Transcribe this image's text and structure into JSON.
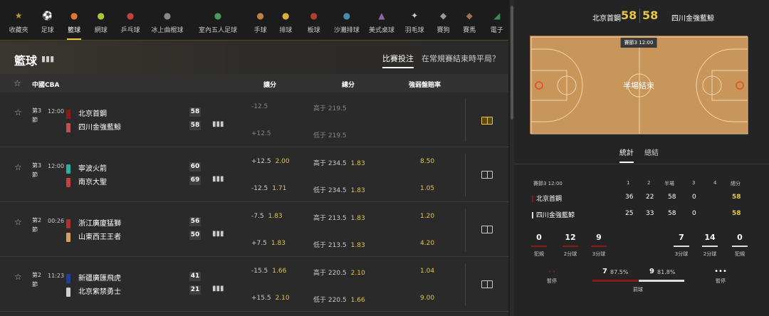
{
  "sports_nav": [
    {
      "label": "收藏夾",
      "icon": "star-icon",
      "color": "#b8963a",
      "glyph": "★"
    },
    {
      "label": "足球",
      "icon": "soccer-ball-icon",
      "color": "#e0e0e0",
      "glyph": "⚽"
    },
    {
      "label": "籃球",
      "icon": "basketball-icon",
      "color": "#e07a30",
      "glyph": "●",
      "active": true
    },
    {
      "label": "網球",
      "icon": "tennis-ball-icon",
      "color": "#a8c83a",
      "glyph": "●"
    },
    {
      "label": "乒乓球",
      "icon": "ping-pong-icon",
      "color": "#c04040",
      "glyph": "●"
    },
    {
      "label": "冰上曲棍球",
      "icon": "ice-hockey-icon",
      "color": "#888",
      "glyph": "●"
    },
    {
      "label": "室內五人足球",
      "icon": "futsal-icon",
      "color": "#4a9a5a",
      "glyph": "●"
    },
    {
      "label": "手球",
      "icon": "handball-icon",
      "color": "#c08040",
      "glyph": "●"
    },
    {
      "label": "排球",
      "icon": "volleyball-icon",
      "color": "#d8b040",
      "glyph": "●"
    },
    {
      "label": "板球",
      "icon": "cricket-icon",
      "color": "#b04030",
      "glyph": "●"
    },
    {
      "label": "沙灘排球",
      "icon": "beach-volleyball-icon",
      "color": "#4a8ab0",
      "glyph": "●"
    },
    {
      "label": "美式桌球",
      "icon": "pool-balls-icon",
      "color": "#8a6aa8",
      "glyph": "▲"
    },
    {
      "label": "羽毛球",
      "icon": "shuttlecock-icon",
      "color": "#ccc",
      "glyph": "✦"
    },
    {
      "label": "賽狗",
      "icon": "greyhound-icon",
      "color": "#999",
      "glyph": "◆"
    },
    {
      "label": "賽馬",
      "icon": "horse-icon",
      "color": "#a07050",
      "glyph": "◆"
    },
    {
      "label": "電子",
      "icon": "esports-icon",
      "color": "#3a8a5a",
      "glyph": "◢"
    }
  ],
  "header": {
    "title": "籃球",
    "tab_active": "比賽投注",
    "tab_other": "在常規賽結束時平局？"
  },
  "columns": {
    "league": "中國CBA",
    "handicap": "讓分",
    "total": "總分",
    "moneyline": "強弱盤賠率"
  },
  "matches": [
    {
      "period": "第3節",
      "time": "12:00",
      "home": {
        "name": "北京首鋼",
        "score": "58",
        "color": "#8a1a1a"
      },
      "away": {
        "name": "四川金強藍鯨",
        "score": "58",
        "color": "#c05050"
      },
      "hcp_home": {
        "line": "-12.5",
        "odds": ""
      },
      "hcp_away": {
        "line": "+12.5",
        "odds": ""
      },
      "tot_over": {
        "line": "高于 219.5",
        "odds": ""
      },
      "tot_under": {
        "line": "低于 219.5",
        "odds": ""
      },
      "ml_home": "",
      "ml_away": "",
      "locked": true,
      "pitch_active": true
    },
    {
      "period": "第3節",
      "time": "12:00",
      "home": {
        "name": "寧波火箭",
        "score": "60",
        "color": "#2ab0a0"
      },
      "away": {
        "name": "南京大聖",
        "score": "69",
        "color": "#c04040"
      },
      "hcp_home": {
        "line": "+12.5",
        "odds": "2.00"
      },
      "hcp_away": {
        "line": "-12.5",
        "odds": "1.71"
      },
      "tot_over": {
        "line": "高于 234.5",
        "odds": "1.83"
      },
      "tot_under": {
        "line": "低于 234.5",
        "odds": "1.83"
      },
      "ml_home": "8.50",
      "ml_away": "1.05",
      "locked": false,
      "pitch_active": false
    },
    {
      "period": "第2節",
      "time": "00:26",
      "home": {
        "name": "浙江廣廈猛獅",
        "score": "56",
        "color": "#b03030"
      },
      "away": {
        "name": "山東西王王者",
        "score": "50",
        "color": "#d8a060"
      },
      "hcp_home": {
        "line": "-7.5",
        "odds": "1.83"
      },
      "hcp_away": {
        "line": "+7.5",
        "odds": "1.83"
      },
      "tot_over": {
        "line": "高于 213.5",
        "odds": "1.83"
      },
      "tot_under": {
        "line": "低于 213.5",
        "odds": "1.83"
      },
      "ml_home": "1.20",
      "ml_away": "4.20",
      "locked": false,
      "pitch_active": false
    },
    {
      "period": "第2節",
      "time": "11:23",
      "home": {
        "name": "新疆廣匯飛虎",
        "score": "41",
        "color": "#2040a0"
      },
      "away": {
        "name": "北京紫禁勇士",
        "score": "21",
        "color": "#d0d0d0"
      },
      "hcp_home": {
        "line": "-15.5",
        "odds": "1.66"
      },
      "hcp_away": {
        "line": "+15.5",
        "odds": "2.10"
      },
      "tot_over": {
        "line": "高于 220.5",
        "odds": "2.10"
      },
      "tot_under": {
        "line": "低于 220.5",
        "odds": "1.66"
      },
      "ml_home": "1.04",
      "ml_away": "9.00",
      "locked": false,
      "pitch_active": false
    }
  ],
  "detail": {
    "home": "北京首鋼",
    "away": "四川金強藍鯨",
    "home_score": "58",
    "away_score": "58",
    "court_badge": "賽節3  12:00",
    "court_msg": "半場結束",
    "tab_stats": "統計",
    "tab_summary": "總結",
    "table_head": {
      "period": "賽節3  12:00",
      "q1": "1",
      "q2": "2",
      "half": "半場",
      "q3": "3",
      "q4": "4",
      "total": "總分"
    },
    "rows": [
      {
        "team": "北京首鋼",
        "q1": "36",
        "q2": "22",
        "half": "58",
        "q3": "0",
        "q4": "",
        "total": "58",
        "color": "#8a1a1a"
      },
      {
        "team": "四川金強藍鯨",
        "q1": "25",
        "q2": "33",
        "half": "58",
        "q3": "0",
        "q4": "",
        "total": "58",
        "color": "#ddd"
      }
    ],
    "home_stats": [
      {
        "value": "0",
        "label": "犯規"
      },
      {
        "value": "12",
        "label": "2分球"
      },
      {
        "value": "9",
        "label": "3分球"
      }
    ],
    "away_stats": [
      {
        "value": "7",
        "label": "3分球"
      },
      {
        "value": "14",
        "label": "2分球"
      },
      {
        "value": "0",
        "label": "犯規"
      }
    ],
    "timeout_label": "暫停",
    "ft_home": "7",
    "ft_home_pct": "87.5%",
    "ft_away": "9",
    "ft_away_pct": "81.8%",
    "ft_label": "罰球",
    "home_color": "#8a1a1a",
    "away_color": "#dddddd"
  }
}
